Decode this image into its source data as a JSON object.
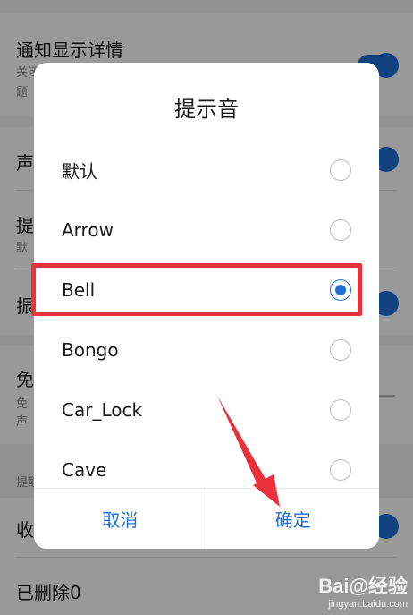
{
  "background": {
    "rows": [
      {
        "title": "通知显示详情",
        "sub1": "关闭",
        "sub2": "题"
      },
      {
        "title": "声"
      },
      {
        "title": "提",
        "sub1": "默"
      },
      {
        "title": "振"
      },
      {
        "title": "免",
        "sub1": "免",
        "sub2": "声"
      },
      {
        "section": "提醒"
      },
      {
        "title": "收"
      },
      {
        "title": "已删除0"
      }
    ]
  },
  "dialog": {
    "title": "提示音",
    "options": [
      {
        "label": "默认",
        "checked": false
      },
      {
        "label": "Arrow",
        "checked": false
      },
      {
        "label": "Bell",
        "checked": true
      },
      {
        "label": "Bongo",
        "checked": false
      },
      {
        "label": "Car_Lock",
        "checked": false
      },
      {
        "label": "Cave",
        "checked": false
      }
    ],
    "cancel_label": "取消",
    "confirm_label": "确定"
  },
  "watermark": {
    "main": "Bai@经验",
    "sub": "jingyan.baidu.com"
  },
  "colors": {
    "accent": "#1f6fd6",
    "highlight": "#e8313a",
    "arrow": "#e8313a"
  }
}
